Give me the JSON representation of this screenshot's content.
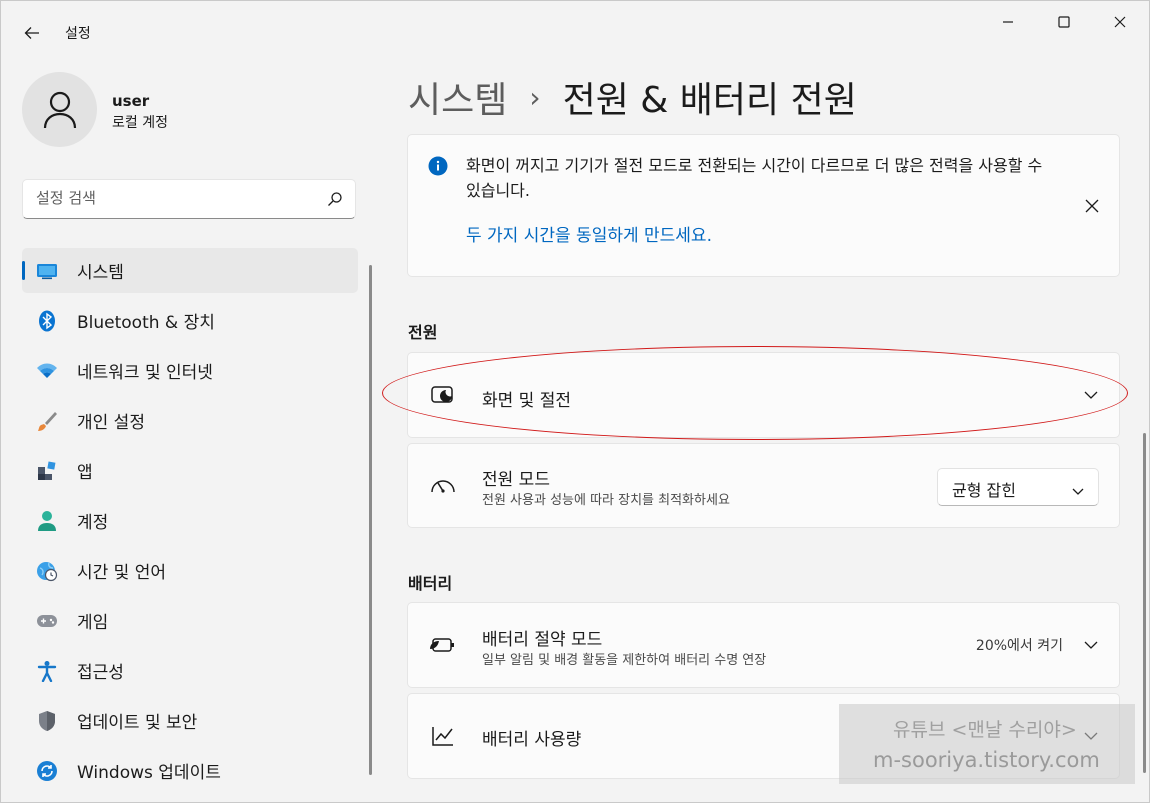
{
  "window": {
    "app_title": "설정"
  },
  "profile": {
    "name": "user",
    "account_type": "로컬 계정"
  },
  "search": {
    "placeholder": "설정 검색"
  },
  "sidebar": {
    "items": [
      {
        "label": "시스템",
        "icon": "system-icon",
        "active": true
      },
      {
        "label": "Bluetooth & 장치",
        "icon": "bluetooth-icon"
      },
      {
        "label": "네트워크 및 인터넷",
        "icon": "wifi-icon"
      },
      {
        "label": "개인 설정",
        "icon": "brush-icon"
      },
      {
        "label": "앱",
        "icon": "apps-icon"
      },
      {
        "label": "계정",
        "icon": "account-icon"
      },
      {
        "label": "시간 및 언어",
        "icon": "globe-clock-icon"
      },
      {
        "label": "게임",
        "icon": "gamepad-icon"
      },
      {
        "label": "접근성",
        "icon": "accessibility-icon"
      },
      {
        "label": "업데이트 및 보안",
        "icon": "shield-icon"
      },
      {
        "label": "Windows 업데이트",
        "icon": "update-icon"
      }
    ]
  },
  "breadcrumb": {
    "parent": "시스템",
    "separator": "›",
    "current": "전원 & 배터리 전원"
  },
  "info_banner": {
    "text": "화면이 꺼지고 기기가 절전 모드로 전환되는 시간이 다르므로 더 많은 전력을 사용할 수 있습니다.",
    "link": "두 가지 시간을 동일하게 만드세요."
  },
  "power_section": {
    "title": "전원",
    "screen_sleep": {
      "title": "화면 및 절전"
    },
    "power_mode": {
      "title": "전원 모드",
      "subtitle": "전원 사용과 성능에 따라 장치를 최적화하세요",
      "selected": "균형 잡힌"
    }
  },
  "battery_section": {
    "title": "배터리",
    "saver": {
      "title": "배터리 절약 모드",
      "subtitle": "일부 알림 및 배경 활동을 제한하여 배터리 수명 연장",
      "value": "20%에서 켜기"
    },
    "usage": {
      "title": "배터리 사용량"
    }
  },
  "watermark": {
    "line1": "유튜브 <맨날 수리야>",
    "line2": "m-sooriya.tistory.com"
  },
  "colors": {
    "accent": "#0067c0",
    "annotation": "#d11a1a"
  }
}
